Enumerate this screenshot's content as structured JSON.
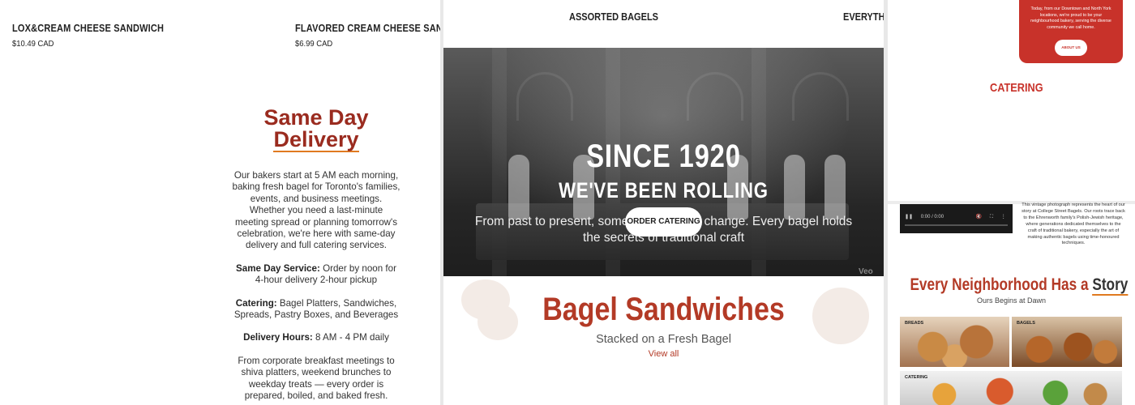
{
  "panel1": {
    "products": [
      {
        "name": "LOX&CREAM CHEESE SANDWICH",
        "price": "$10.49 CAD"
      },
      {
        "name": "FLAVORED CREAM CHEESE SANDWICH",
        "price": "$6.99 CAD"
      }
    ],
    "delivery": {
      "title_line1": "Same Day",
      "title_line2": "Delivery",
      "intro": "Our bakers start at 5 AM each morning, baking fresh bagel for Toronto's families, events, and business meetings. Whether you need a last-minute meeting spread or planning tomorrow's celebration, we're here with same-day delivery and full catering services.",
      "same_day_label": "Same Day Service:",
      "same_day_text": "Order by noon for 4-hour delivery 2-hour pickup",
      "catering_label": "Catering:",
      "catering_text": "Bagel Platters, Sandwiches, Spreads, Pastry Boxes, and Beverages",
      "hours_label": "Delivery Hours:",
      "hours_text": "8 AM - 4 PM daily",
      "closing": "From corporate breakfast meetings to shiva platters, weekend brunches to weekday treats — every order is prepared, boiled, and baked fresh."
    }
  },
  "panel2": {
    "top_labels": [
      "ASSORTED BAGELS",
      "EVERYTHIN"
    ],
    "hero": {
      "title1": "SINCE 1920",
      "title2": "WE'VE BEEN ROLLING",
      "subtitle": "From past to present, some things never change. Every bagel holds the secrets of traditional craft",
      "button": "ORDER CATERING",
      "watermark": "Veo"
    },
    "section": {
      "title": "Bagel Sandwiches",
      "subtitle": "Stacked on a Fresh Bagel",
      "link": "View all"
    }
  },
  "panel3": {
    "red_card_text": "Today, from our Downtown and North York locations, we're proud to be your neighbourhood bakery, serving the diverse community we call home.",
    "about_button": "ABOUT US",
    "catering_heading": "CATERING",
    "video_time": "0:00 / 0:00",
    "video_desc": "This vintage photograph represents the heart of our story at College Street Bagels. Our roots trace back to the Ehrenworth family's Polish-Jewish heritage, where generations dedicated themselves to the craft of traditional bakery, especially the art of making authentic bagels using time-honoured techniques.",
    "story_title_a": "Every Neighborhood Has a",
    "story_title_b": "Story",
    "story_subtitle": "Ours Begins at Dawn",
    "tiles": [
      "BREADS",
      "BAGELS",
      "CATERING"
    ]
  },
  "colors": {
    "brand_red": "#b33a26",
    "accent_orange": "#e07a20",
    "card_red": "#c8322a"
  }
}
